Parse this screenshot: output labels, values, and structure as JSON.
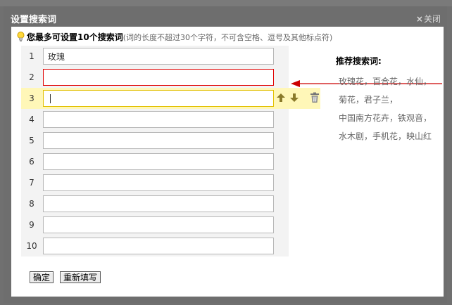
{
  "dialog": {
    "title": "设置搜索词",
    "close_label": "关闭",
    "close_icon": "×"
  },
  "tip": {
    "strong": "您最多可设置10个搜索词",
    "note": "(词的长度不超过30个字符，不可含空格、逗号及其他标点符)"
  },
  "keywords": [
    {
      "num": "1",
      "value": "玫瑰",
      "state": "normal"
    },
    {
      "num": "2",
      "value": "",
      "state": "error"
    },
    {
      "num": "3",
      "value": "",
      "state": "focus"
    },
    {
      "num": "4",
      "value": "",
      "state": "normal"
    },
    {
      "num": "5",
      "value": "",
      "state": "normal"
    },
    {
      "num": "6",
      "value": "",
      "state": "normal"
    },
    {
      "num": "7",
      "value": "",
      "state": "normal"
    },
    {
      "num": "8",
      "value": "",
      "state": "normal"
    },
    {
      "num": "9",
      "value": "",
      "state": "normal"
    },
    {
      "num": "10",
      "value": "",
      "state": "normal"
    }
  ],
  "recommend": {
    "head": "推荐搜索词:",
    "lines": [
      "玫瑰花，百合花，水仙，",
      "菊花，君子兰，",
      "中国南方花卉，铁观音，",
      "水木剧，手机花，映山红"
    ]
  },
  "buttons": {
    "confirm": "确定",
    "reset": "重新填写"
  },
  "colors": {
    "overlay": "#707070",
    "error_border": "#e00000",
    "active_row": "#fff7b8",
    "arrow": "#cc0000"
  }
}
